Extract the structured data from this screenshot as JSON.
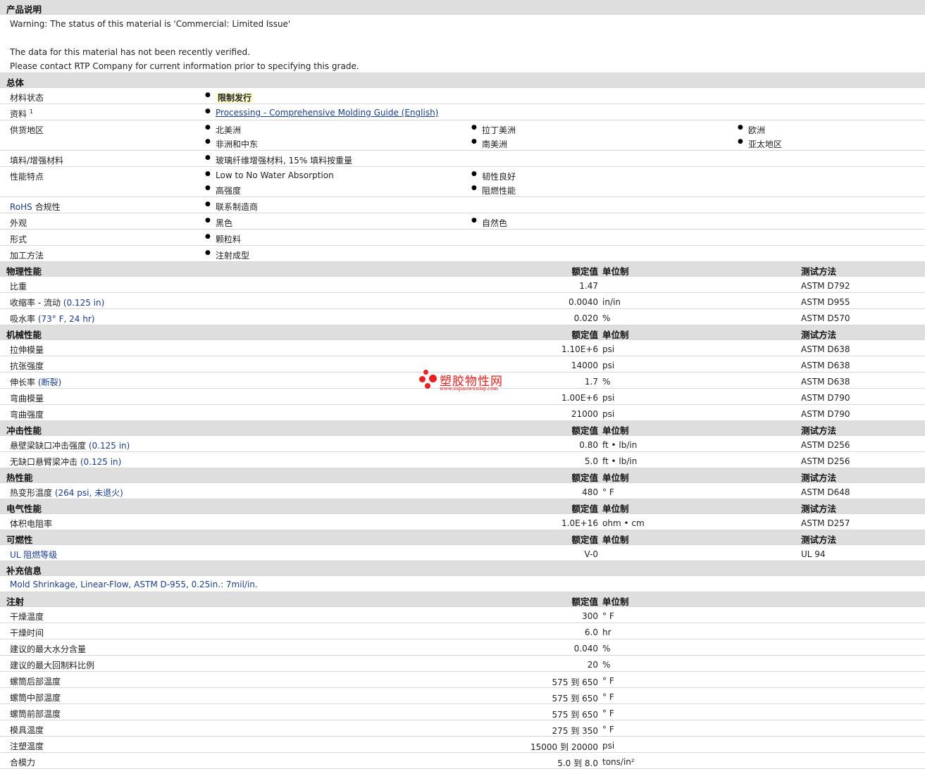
{
  "desc": {
    "title": "产品说明",
    "line1": "Warning: The status of this material is 'Commercial: Limited Issue'",
    "line2": "The data for this material has not been recently verified.",
    "line3": "Please contact RTP Company for current information prior to specifying this grade."
  },
  "general": {
    "title": "总体",
    "status_label": "材料状态",
    "status_value": "限制发行",
    "resource_label": "资料",
    "resource_sup": "1",
    "resource_link": "Processing - Comprehensive Molding Guide (English)",
    "supply_label": "供货地区",
    "supply": [
      "北美洲",
      "拉丁美洲",
      "欧洲",
      "非洲和中东",
      "南美洲",
      "亚太地区"
    ],
    "filler_label": "填料/增强材料",
    "filler_value": "玻璃纤维增强材料, 15% 填料按重量",
    "feature_label": "性能特点",
    "features": [
      "Low to No Water Absorption",
      "韧性良好",
      "高强度",
      "阻燃性能"
    ],
    "rohs_label_en": "RoHS",
    "rohs_label_cn": "合规性",
    "rohs_value": "联系制造商",
    "appearance_label": "外观",
    "appearance": [
      "黑色",
      "自然色"
    ],
    "form_label": "形式",
    "form_value": "颗粒料",
    "process_label": "加工方法",
    "process_value": "注射成型"
  },
  "cols": {
    "value": "额定值",
    "unit": "单位制",
    "test": "测试方法"
  },
  "physical": {
    "title": "物理性能",
    "rows": [
      {
        "label": "比重",
        "cond": "",
        "value": "1.47",
        "unit": "",
        "test": "ASTM D792"
      },
      {
        "label": "收缩率 - 流动",
        "cond": "(0.125 in)",
        "value": "0.0040",
        "unit": "in/in",
        "test": "ASTM D955"
      },
      {
        "label": "吸水率",
        "cond": "(73° F, 24 hr)",
        "value": "0.020",
        "unit": "%",
        "test": "ASTM D570"
      }
    ]
  },
  "mechanical": {
    "title": "机械性能",
    "rows": [
      {
        "label": "拉伸模量",
        "cond": "",
        "value": "1.10E+6",
        "unit": "psi",
        "test": "ASTM D638"
      },
      {
        "label": "抗张强度",
        "cond": "",
        "value": "14000",
        "unit": "psi",
        "test": "ASTM D638"
      },
      {
        "label": "伸长率",
        "cond": "(断裂)",
        "value": "1.7",
        "unit": "%",
        "test": "ASTM D638"
      },
      {
        "label": "弯曲模量",
        "cond": "",
        "value": "1.00E+6",
        "unit": "psi",
        "test": "ASTM D790"
      },
      {
        "label": "弯曲强度",
        "cond": "",
        "value": "21000",
        "unit": "psi",
        "test": "ASTM D790"
      }
    ]
  },
  "impact": {
    "title": "冲击性能",
    "rows": [
      {
        "label": "悬壁梁缺口冲击强度",
        "cond": "(0.125 in)",
        "value": "0.80",
        "unit": "ft • lb/in",
        "test": "ASTM D256"
      },
      {
        "label": "无缺口悬臂梁冲击",
        "cond": "(0.125 in)",
        "value": "5.0",
        "unit": "ft • lb/in",
        "test": "ASTM D256"
      }
    ]
  },
  "thermal": {
    "title": "热性能",
    "rows": [
      {
        "label": "热变形温度",
        "cond": "(264 psi, 未退火)",
        "value": "480",
        "unit": "° F",
        "test": "ASTM D648"
      }
    ]
  },
  "electrical": {
    "title": "电气性能",
    "rows": [
      {
        "label": "体积电阻率",
        "cond": "",
        "value": "1.0E+16",
        "unit": "ohm • cm",
        "test": "ASTM D257"
      }
    ]
  },
  "flammability": {
    "title": "可燃性",
    "rows": [
      {
        "label": "UL 阻燃等级",
        "cond": "",
        "value": "V-0",
        "unit": "",
        "test": "UL 94"
      }
    ]
  },
  "supplement": {
    "title": "补充信息",
    "text": "Mold Shrinkage, Linear-Flow, ASTM D-955, 0.25in.: 7mil/in."
  },
  "injection": {
    "title": "注射",
    "rows": [
      {
        "label": "干燥温度",
        "value": "300",
        "unit": "° F"
      },
      {
        "label": "干燥时间",
        "value": "6.0",
        "unit": "hr"
      },
      {
        "label": "建议的最大水分含量",
        "value": "0.040",
        "unit": "%"
      },
      {
        "label": "建议的最大回制料比例",
        "value": "20",
        "unit": "%"
      },
      {
        "label": "螺筒后部温度",
        "value": "575 到 650",
        "unit": "° F"
      },
      {
        "label": "螺筒中部温度",
        "value": "575 到 650",
        "unit": "° F"
      },
      {
        "label": "螺筒前部温度",
        "value": "575 到 650",
        "unit": "° F"
      },
      {
        "label": "模具温度",
        "value": "275 到 350",
        "unit": "° F"
      },
      {
        "label": "注塑温度",
        "value": "15000 到 20000",
        "unit": "psi"
      },
      {
        "label": "合模力",
        "value": "5.0 到 8.0",
        "unit": "tons/in²"
      }
    ]
  },
  "watermark": {
    "cn": "塑胶物性网",
    "en": "www.sujiaowuxing.com"
  }
}
